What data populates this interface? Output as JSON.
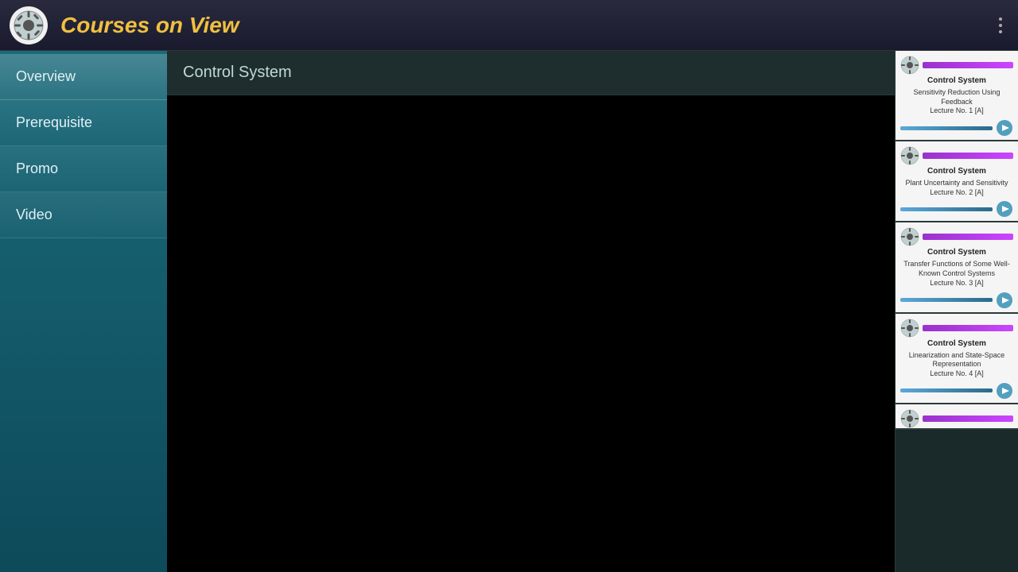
{
  "app": {
    "title": "Courses on View",
    "menu_icon": "more-vertical-icon"
  },
  "sidebar": {
    "items": [
      {
        "id": "overview",
        "label": "Overview",
        "active": true
      },
      {
        "id": "prerequisite",
        "label": "Prerequisite",
        "active": false
      },
      {
        "id": "promo",
        "label": "Promo",
        "active": false
      },
      {
        "id": "video",
        "label": "Video",
        "active": false
      }
    ]
  },
  "content": {
    "course_title": "Control System"
  },
  "lectures": [
    {
      "course": "Control System",
      "title": "Sensitivity Reduction Using Feedback",
      "subtitle": "Lecture No. 1 [A]"
    },
    {
      "course": "Control System",
      "title": "Plant Uncertainty and Sensitivity",
      "subtitle": "Lecture No. 2 [A]"
    },
    {
      "course": "Control System",
      "title": "Transfer Functions of Some Well-Known Control Systems",
      "subtitle": "Lecture No. 3 [A]"
    },
    {
      "course": "Control System",
      "title": "Linearization and State-Space Representation",
      "subtitle": "Lecture No. 4 [A]"
    }
  ]
}
